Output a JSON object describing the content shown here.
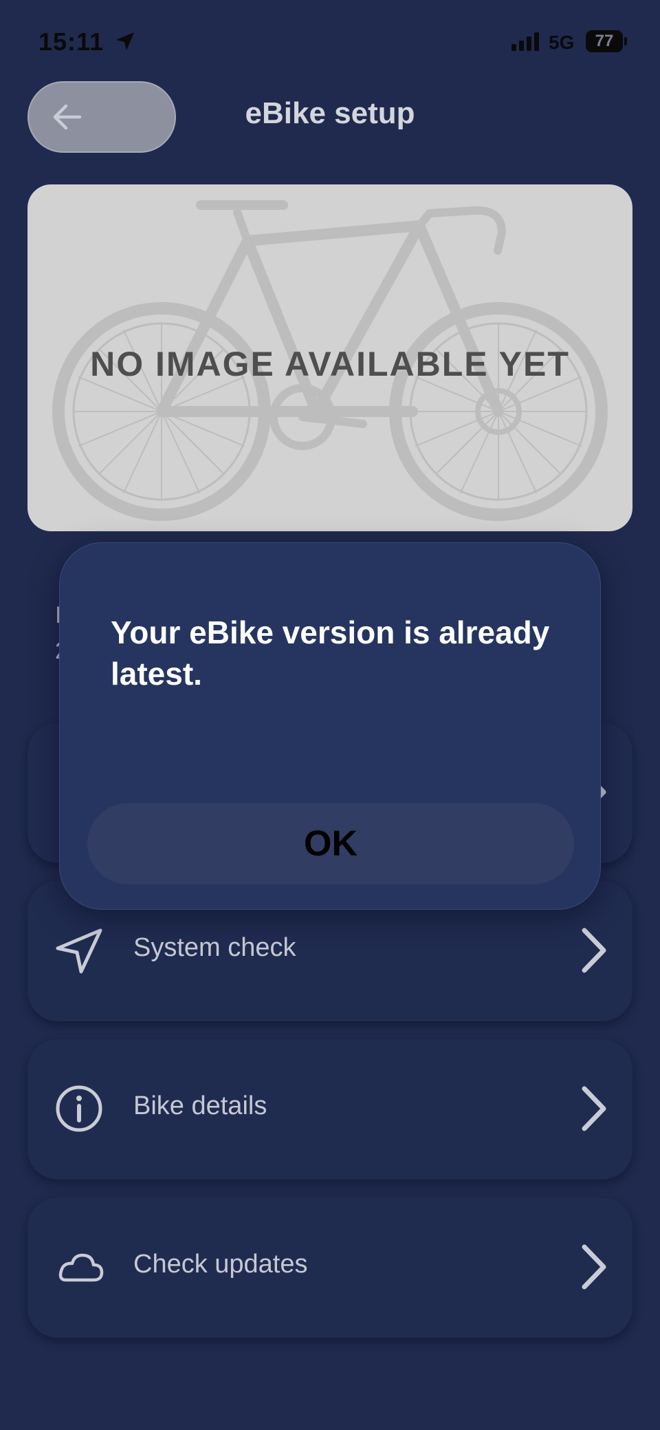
{
  "status_bar": {
    "time": "15:11",
    "network": "5G",
    "battery": "77"
  },
  "header": {
    "title": "eBike setup"
  },
  "bike_image": {
    "placeholder_text": "NO IMAGE AVAILABLE YET"
  },
  "hidden_info": {
    "line1_fragment": "I",
    "line2_fragment": "2",
    "right_fragment": "."
  },
  "menu": {
    "items": [
      {
        "label": "",
        "icon": "partially-hidden-icon"
      },
      {
        "label": "System check",
        "icon": "navigation-arrow-icon"
      },
      {
        "label": "Bike details",
        "icon": "info-circle-icon"
      },
      {
        "label": "Check updates",
        "icon": "cloud-icon"
      }
    ]
  },
  "dialog": {
    "message": "Your eBike version is already latest.",
    "ok_label": "OK"
  },
  "colors": {
    "background": "#1f2a4e",
    "card": "#202b50",
    "dialog": "#263560",
    "text_light": "#c6c8d2"
  }
}
